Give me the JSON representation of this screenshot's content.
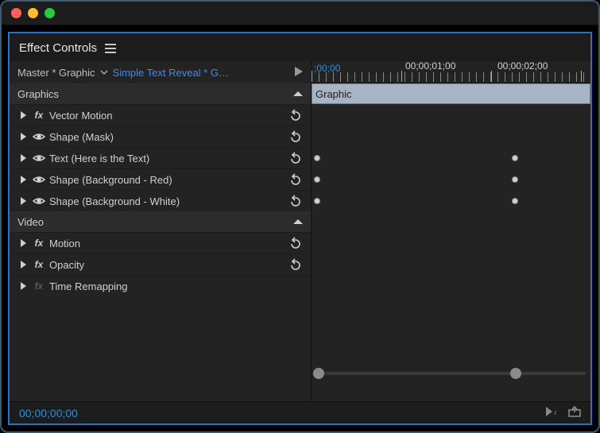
{
  "panel": {
    "title": "Effect Controls"
  },
  "breadcrumb": {
    "master": "Master * Graphic",
    "clip": "Simple Text Reveal * G…"
  },
  "groups": [
    {
      "name": "Graphics",
      "items": [
        {
          "label": "Vector Motion",
          "icon": "fx",
          "hasReset": true
        },
        {
          "label": "Shape (Mask)",
          "icon": "eye",
          "hasReset": true
        },
        {
          "label": "Text (Here is the Text)",
          "icon": "eye",
          "hasReset": true,
          "kf": true
        },
        {
          "label": "Shape (Background - Red)",
          "icon": "eye",
          "hasReset": true,
          "kf": true
        },
        {
          "label": "Shape (Background - White)",
          "icon": "eye",
          "hasReset": true,
          "kf": true
        }
      ]
    },
    {
      "name": "Video",
      "items": [
        {
          "label": "Motion",
          "icon": "fx",
          "hasReset": true
        },
        {
          "label": "Opacity",
          "icon": "fx",
          "hasReset": true
        },
        {
          "label": "Time Remapping",
          "icon": "fx-dim",
          "hasReset": false
        }
      ]
    }
  ],
  "timeline": {
    "playhead": ";00;00",
    "labels": [
      "00;00;01;00",
      "00;00;02;00"
    ],
    "clipLabel": "Graphic"
  },
  "footer": {
    "timecode": "00;00;00;00"
  }
}
